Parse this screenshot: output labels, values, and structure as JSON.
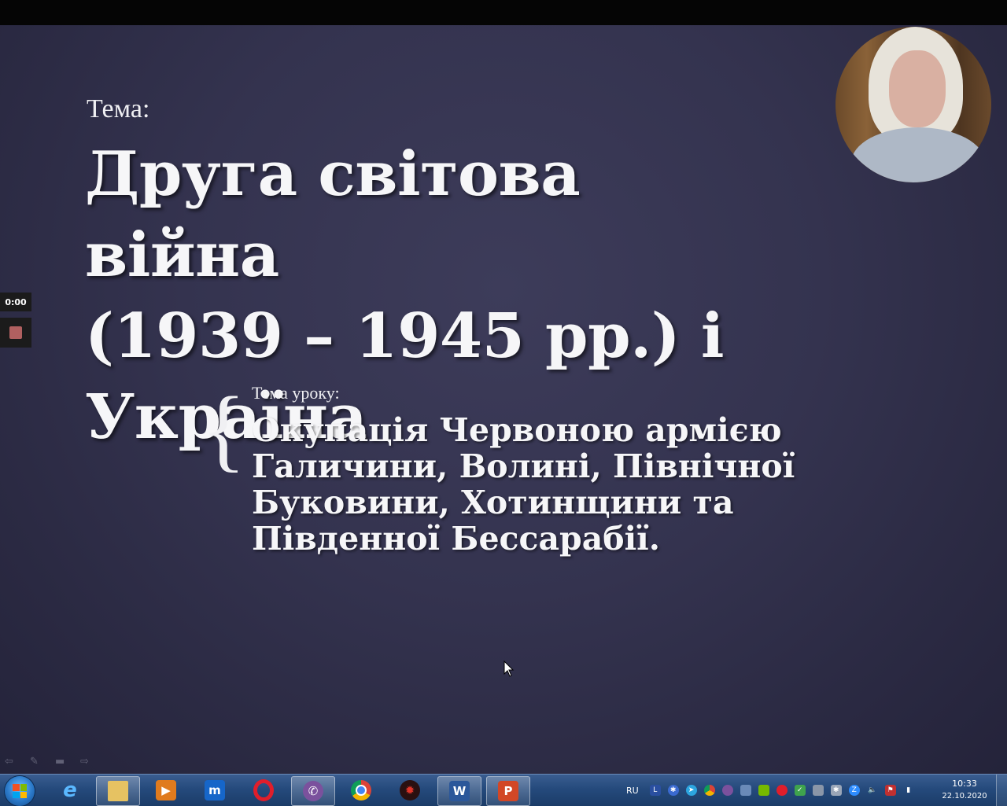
{
  "slide": {
    "label": "Тема:",
    "title_lines": [
      "Друга світова війна",
      "(1939 – 1945 рр.) і",
      "Україна"
    ],
    "lesson_label": "Тема уроку:",
    "lesson_lines": [
      "Окупація Червоною армією",
      "Галичини, Волині, Північної",
      "Буковини, Хотинщини та",
      "Південної Бессарабії."
    ],
    "brace": "{"
  },
  "recorder": {
    "elapsed": "0:00",
    "stop_icon": "stop-icon"
  },
  "slideshow_toolbar": [
    "arrow-left-icon",
    "pen-icon",
    "slides-icon",
    "arrow-right-icon"
  ],
  "taskbar": {
    "start_icon": "windows-start-icon",
    "apps": [
      {
        "name": "internet-explorer",
        "glyph": "e",
        "color": "#1e8fe0"
      },
      {
        "name": "file-explorer",
        "glyph": "",
        "color": "#e6c262"
      },
      {
        "name": "media-player",
        "glyph": "▶",
        "color": "#e07b1e"
      },
      {
        "name": "maxthon",
        "glyph": "m",
        "color": "#1666c9"
      },
      {
        "name": "opera",
        "glyph": "O",
        "color": "#e01e2b"
      },
      {
        "name": "viber",
        "glyph": "✆",
        "color": "#7b519d"
      },
      {
        "name": "chrome",
        "glyph": "",
        "color": "#2e9e47"
      },
      {
        "name": "app-red",
        "glyph": "✹",
        "color": "#c7221a"
      },
      {
        "name": "word",
        "glyph": "W",
        "color": "#2b579a"
      },
      {
        "name": "powerpoint",
        "glyph": "P",
        "color": "#d24726"
      }
    ],
    "tray": {
      "language": "RU",
      "icons": [
        "lav-icon",
        "gear-icon",
        "telegram-icon",
        "chrome-icon",
        "viber-icon",
        "network-icon",
        "nvidia-icon",
        "opera-icon",
        "update-icon",
        "usb-icon",
        "settings-icon",
        "zoom-icon",
        "volume-icon",
        "flag-icon",
        "signal-icon"
      ]
    },
    "clock": {
      "time": "10:33",
      "date": "22.10.2020"
    }
  },
  "colors": {
    "slide_bg": "#34334f",
    "taskbar": "#254a7c",
    "text": "#f6f6f8"
  }
}
